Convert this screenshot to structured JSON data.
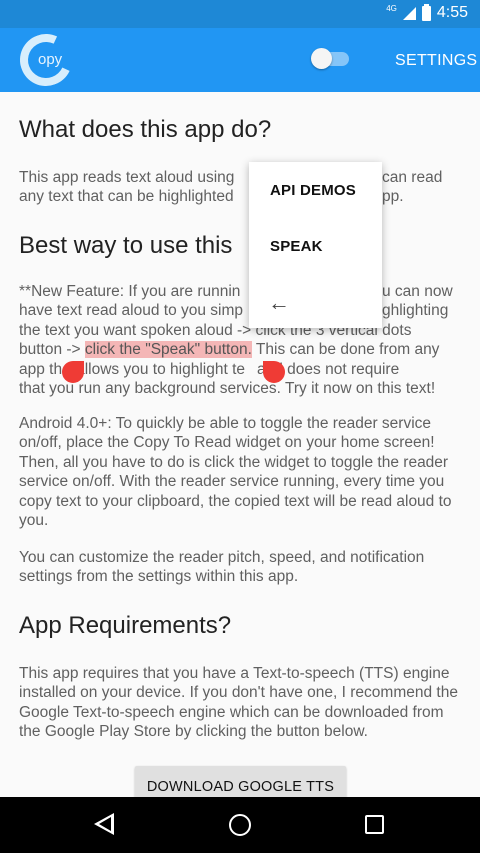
{
  "status_bar": {
    "network": "4G",
    "time": "4:55"
  },
  "app_bar": {
    "logo_text": "opy",
    "toggle_state": "off",
    "settings_label": "SETTINGS"
  },
  "content": {
    "heading_1": "What does this app do?",
    "para_1_lines": [
      "This app reads text aloud using",
      "any text that can be highlighted"
    ],
    "para_1_right_lines": [
      "can read",
      "pp."
    ],
    "heading_2": "Best way to use this",
    "para_2_lines": [
      "**New Feature: If you are runnin",
      "have text read aloud to you simp",
      "the text you want spoken aloud -> click the 3 vertical dots",
      "button -> ",
      "click the \"Speak\" button.",
      " This can be done from any",
      "app th",
      "allows you to highlight te",
      "and does not require",
      "that you run any background services. Try it now on this text!"
    ],
    "para_2_right_lines": [
      "u can now",
      "ghlighting"
    ],
    "para_3": "Android 4.0+: To quickly be able to toggle the reader service on/off, place the Copy To Read widget on your home screen! Then, all you have to do is click the widget to toggle the reader service on/off. With the reader service running, every time you copy text to your clipboard, the copied text will be read aloud to you.",
    "para_4": "You can customize the reader pitch, speed, and notification settings from the settings within this app.",
    "heading_3": "App Requirements?",
    "para_5": "This app requires that you have a Text-to-speech (TTS) engine installed on your device. If you don't have one, I recommend the Google Text-to-speech engine which can be downloaded from the Google Play Store by clicking the button below.",
    "download_button": "DOWNLOAD GOOGLE TTS"
  },
  "popup_menu": {
    "items": [
      "API DEMOS",
      "SPEAK"
    ],
    "back_icon": "arrow-left-icon"
  },
  "colors": {
    "status_bar": "#1e88d6",
    "app_bar": "#2196f3",
    "highlight": "#f4b6b6",
    "selection_handle": "#ef3b35"
  }
}
